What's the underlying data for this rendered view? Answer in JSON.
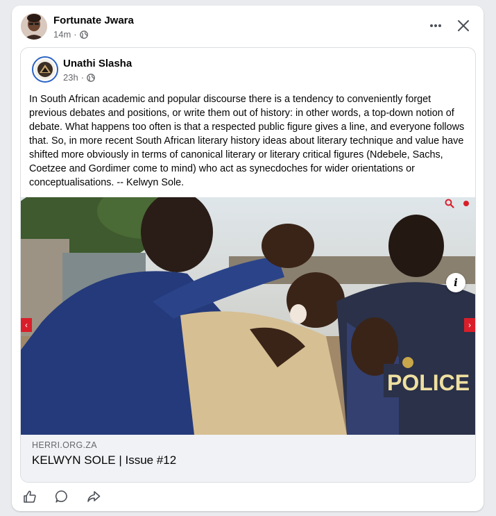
{
  "post": {
    "author": "Fortunate Jwara",
    "time": "14m",
    "privacy_icon": "globe-icon",
    "more_icon": "more-options-icon",
    "close_icon": "close-icon"
  },
  "shared_post": {
    "author": "Unathi Slasha",
    "time": "23h",
    "privacy_icon": "globe-icon",
    "text": "In South African academic and popular discourse there is a tendency to conveniently forget previous debates and positions, or write them out of history: in other words, a top-down notion of debate. What happens too often is that a respected public figure gives a line, and everyone follows that. So, in more recent South African literary history ideas about literary technique and value have shifted more obviously in terms of canonical literary or literary critical figures (Ndebele, Sachs, Coetzee and Gordimer come to mind) who act as synecdoches for wider orientations or conceptualisations. -- Kelwyn Sole."
  },
  "link_preview": {
    "domain": "HERRI.ORG.ZA",
    "title": "KELWYN SOLE | Issue #12",
    "photo_text": "POLICE",
    "info_label": "i",
    "prev_arrow": "‹",
    "next_arrow": "›"
  },
  "actions": {
    "like_icon": "like-icon",
    "comment_icon": "comment-icon",
    "share_icon": "share-icon"
  },
  "colors": {
    "accent_red": "#d91e2a",
    "uniform_blue": "#243a7a",
    "secondary_text": "#65676b"
  }
}
